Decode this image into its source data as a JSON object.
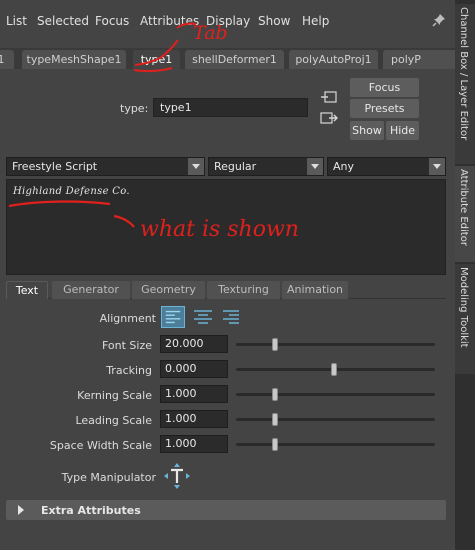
{
  "menubar": {
    "items": [
      "List",
      "Selected",
      "Focus",
      "Attributes",
      "Display",
      "Show",
      "Help"
    ]
  },
  "node_tabs": [
    "1",
    "typeMeshShape1",
    "type1",
    "shellDeformer1",
    "polyAutoProj1",
    "polyP"
  ],
  "active_node_tab": "type1",
  "side_dock": [
    "Channel Box / Layer Editor",
    "Attribute Editor",
    "Modeling Toolkit"
  ],
  "node": {
    "type_label": "type:",
    "name": "type1",
    "buttons": {
      "focus": "Focus",
      "presets": "Presets",
      "show": "Show",
      "hide": "Hide"
    }
  },
  "font": {
    "family": "Freestyle Script",
    "style": "Regular",
    "script": "Any"
  },
  "preview": {
    "text": "Highland Defense Co."
  },
  "subtabs": [
    "Text",
    "Generator",
    "Geometry",
    "Texturing",
    "Animation"
  ],
  "active_subtab": "Text",
  "attributes": {
    "alignment_label": "Alignment",
    "rows": [
      {
        "label": "Font Size",
        "value": "20.000"
      },
      {
        "label": "Tracking",
        "value": "0.000"
      },
      {
        "label": "Kerning Scale",
        "value": "1.000"
      },
      {
        "label": "Leading Scale",
        "value": "1.000"
      },
      {
        "label": "Space Width Scale",
        "value": "1.000"
      }
    ],
    "manipulator_label": "Type Manipulator"
  },
  "extra": {
    "label": "Extra Attributes"
  },
  "annotations": {
    "tab_note": "Tab",
    "shown_note": "what is shown",
    "color": "#e0201c"
  },
  "colors": {
    "panel": "#444444",
    "field": "#2b2b2b",
    "accent": "#6ab4d8"
  }
}
